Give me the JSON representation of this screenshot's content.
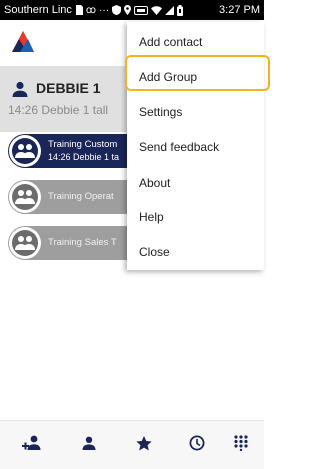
{
  "status_bar": {
    "carrier": "Southern Linc",
    "time": "3:27 PM",
    "icons": [
      "sim-icon",
      "voicemail-icon",
      "more-icon",
      "shield-icon",
      "location-icon",
      "volte-icon",
      "wifi-icon",
      "signal-icon",
      "battery-icon"
    ]
  },
  "app": {
    "logo": "app-logo-icon",
    "brand_colors": {
      "red": "#e8392b",
      "blue": "#1f5fb7",
      "navy": "#1a2657"
    }
  },
  "profile": {
    "name": "DEBBIE 1",
    "last_message": "14:26 Debbie 1 tall"
  },
  "groups": [
    {
      "title": "Training Custom",
      "subtitle": "14:26 Debbie 1 ta",
      "active": true
    },
    {
      "title": "Training Operat",
      "subtitle": "",
      "active": false
    },
    {
      "title": "Training Sales T",
      "subtitle": "",
      "active": false
    }
  ],
  "menu": {
    "items": [
      "Add contact",
      "Add Group",
      "Settings",
      "Send feedback",
      "About",
      "Help",
      "Close"
    ],
    "highlighted": "Add Group",
    "highlight_color": "#f5b324"
  },
  "bottom_nav": {
    "items": [
      "add-group-icon",
      "contact-icon",
      "favorites-star-icon",
      "recents-clock-icon",
      "dialpad-icon"
    ]
  }
}
